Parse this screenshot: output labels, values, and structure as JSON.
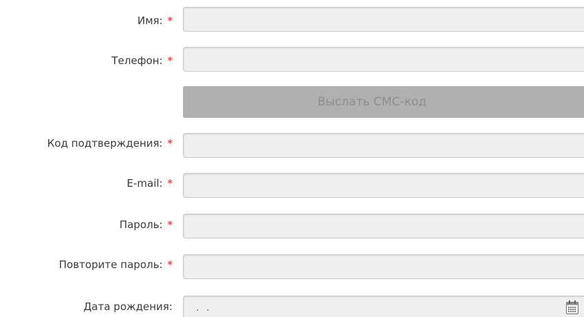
{
  "form": {
    "required_mark": "*",
    "fields": [
      {
        "label": "Имя:",
        "value": "",
        "required": true
      },
      {
        "label": "Телефон:",
        "value": "",
        "required": true
      },
      {
        "label": "Код подтверждения:",
        "value": "",
        "required": true
      },
      {
        "label": "E-mail:",
        "value": "",
        "required": true
      },
      {
        "label": "Пароль:",
        "value": "",
        "required": true
      },
      {
        "label": "Повторите пароль:",
        "value": "",
        "required": true
      }
    ],
    "sms_button_label": "Выслать СМС-код",
    "birthdate": {
      "label": "Дата рождения:",
      "value": ". ."
    }
  },
  "colors": {
    "required_star": "#e02020",
    "input_bg": "#efefef",
    "button_bg": "#b0b0b0",
    "button_text": "#8e8e8e"
  },
  "icons": {
    "calendar": "calendar-icon"
  }
}
